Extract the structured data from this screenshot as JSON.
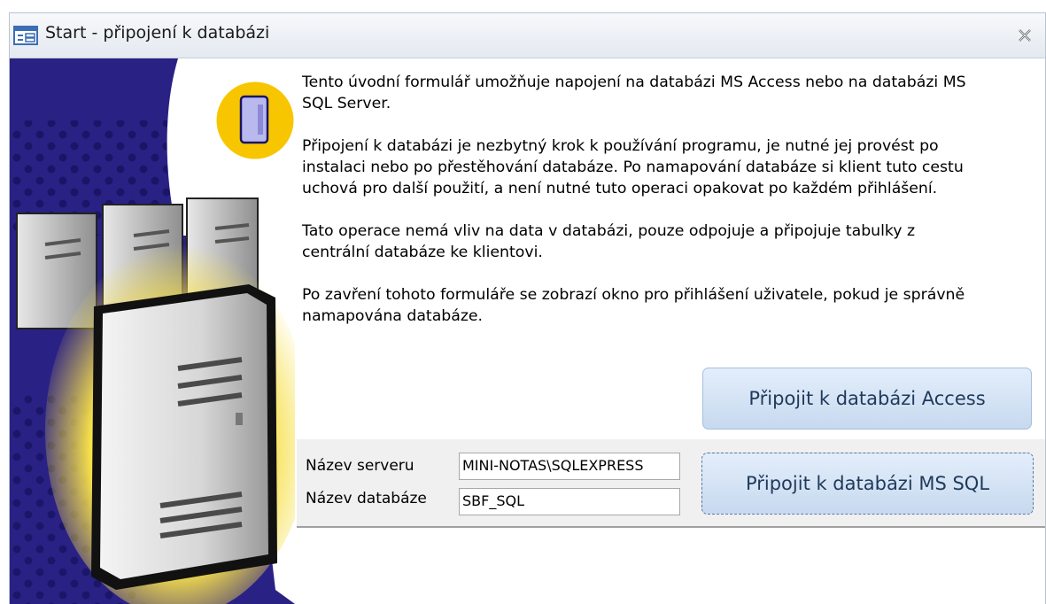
{
  "window": {
    "title": "Start - připojení k databázi",
    "icon": "form-icon",
    "close_icon": "close-icon"
  },
  "paragraphs": [
    "Tento úvodní formulář umožňuje napojení na databázi MS Access nebo na databázi MS\nSQL Server.",
    "Připojení k databázi je nezbytný krok k používání programu, je nutné jej provést po\ninstalaci nebo po přestěhování databáze. Po namapování databáze si klient tuto cestu\nuchová pro další použití, a není nutné tuto operaci opakovat po každém přihlášení.",
    "Tato operace nemá vliv na data v databázi, pouze odpojuje a připojuje tabulky z\ncentrální databáze ke klientovi.",
    "Po zavření tohoto formuláře se zobrazí okno pro přihlášení uživatele, pokud je správně\nnamapována databáze."
  ],
  "access_button": {
    "label": "Připojit k databázi Access"
  },
  "sql": {
    "server_label": "Název serveru",
    "server_value": "MINI-NOTAS\\SQLEXPRESS",
    "database_label": "Název databáze",
    "database_value": "SBF_SQL",
    "button_label": "Připojit k databázi MS SQL"
  },
  "colors": {
    "illustration_navy": "#2a2185",
    "illustration_yellow": "#f7c600",
    "button_fill": "#d4e3f5",
    "button_text": "#1f3a5a"
  }
}
